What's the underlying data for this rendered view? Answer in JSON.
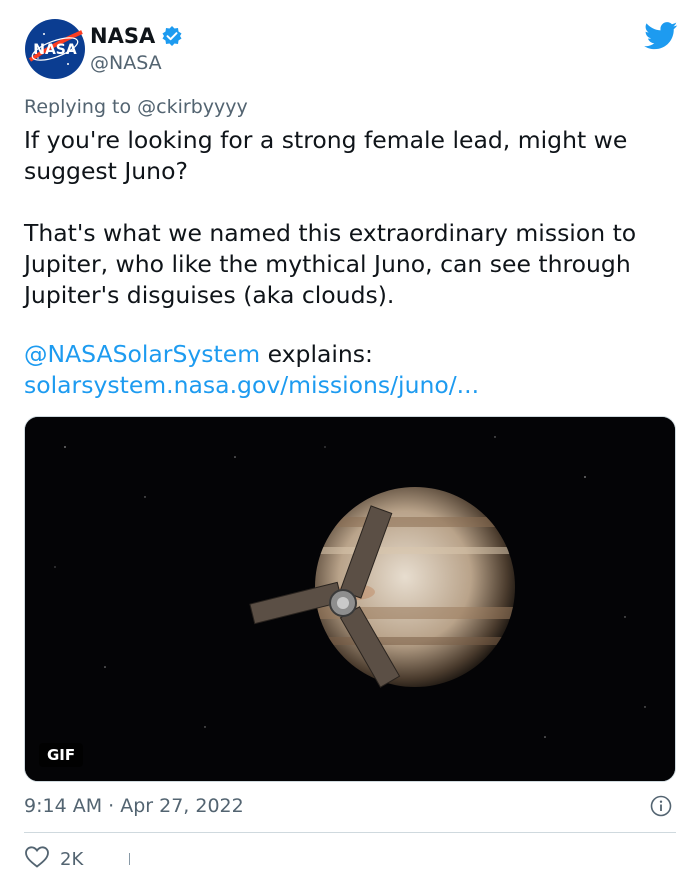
{
  "author": {
    "name": "NASA",
    "handle": "@NASA",
    "verified": true,
    "avatar_text": "NASA"
  },
  "reply": {
    "prefix": "Replying to ",
    "mention": "@ckirbyyyy"
  },
  "tweet": {
    "paragraph1": "If you're looking for a strong female lead, might we suggest Juno?",
    "paragraph2": "That's what we named this extraordinary mission to Jupiter, who like the mythical Juno, can see through Jupiter's disguises (aka clouds).",
    "mention_link": "@NASASolarSystem",
    "mention_suffix": " explains:",
    "url_link": "solarsystem.nasa.gov/missions/juno/..."
  },
  "media": {
    "badge": "GIF"
  },
  "meta": {
    "timestamp": "9:14 AM · Apr 27, 2022"
  },
  "actions": {
    "like_count": "2K"
  },
  "colors": {
    "link": "#1d9bf0",
    "secondary_text": "#536471",
    "twitter_blue": "#1d9bf0"
  },
  "icons": [
    "nasa-logo-avatar",
    "verified-badge-icon",
    "twitter-bird-icon",
    "info-icon",
    "heart-icon"
  ]
}
